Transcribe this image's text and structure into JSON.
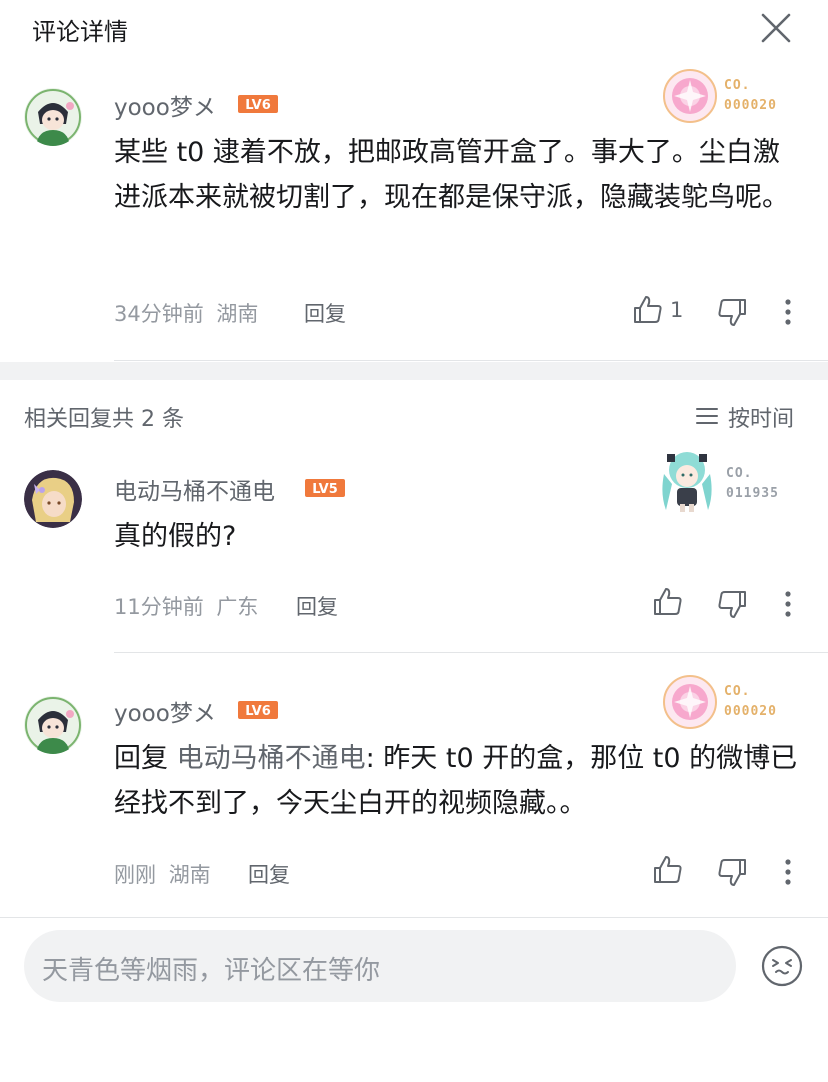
{
  "header": {
    "title": "评论详情"
  },
  "main_comment": {
    "user": "yooo梦メ",
    "level": "LV6",
    "badge_label": "CO.",
    "badge_number": "000020",
    "content": "某些 t0 逮着不放，把邮政高管开盒了。事大了。尘白激进派本来就被切割了，现在都是保守派，隐藏装鸵鸟呢。",
    "time": "34分钟前",
    "location": "湖南",
    "reply_label": "回复",
    "like_count": "1"
  },
  "replies_header": {
    "count_text": "相关回复共 2 条",
    "sort_label": "按时间"
  },
  "replies": [
    {
      "user": "电动马桶不通电",
      "level": "LV5",
      "badge_label": "CO.",
      "badge_number": "011935",
      "content": "真的假的?",
      "time": "11分钟前",
      "location": "广东",
      "reply_label": "回复"
    },
    {
      "user": "yooo梦メ",
      "level": "LV6",
      "badge_label": "CO.",
      "badge_number": "000020",
      "reply_prefix": "回复 ",
      "reply_to": "电动马桶不通电",
      "content": ": 昨天 t0 开的盒，那位 t0 的微博已经找不到了，今天尘白开的视频隐藏。。",
      "time": "刚刚",
      "location": "湖南",
      "reply_label": "回复"
    }
  ],
  "input": {
    "placeholder": "天青色等烟雨，评论区在等你"
  },
  "colors": {
    "level_badge": "#f0793c",
    "collection_badge": "#e4b16a",
    "collection_badge_gray": "#9aa0a8",
    "link": "#61666d"
  }
}
